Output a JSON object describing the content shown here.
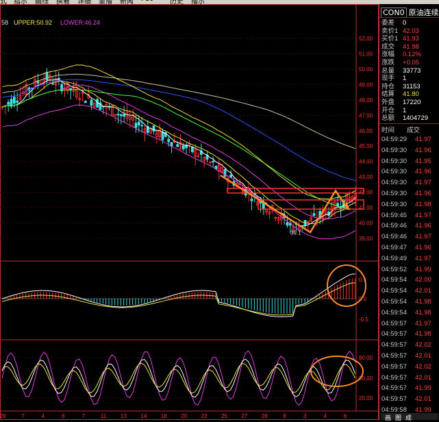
{
  "menu": [
    "式",
    "指示",
    "画线",
    "换着",
    "详细",
    "重播",
    "新闻",
    "F10",
    "历史",
    "播示"
  ],
  "legend": {
    "mid": "58",
    "upper": "UPPER:50.92",
    "lower": "LOWER:46.24"
  },
  "price_axis": [
    "52.00",
    "51.00",
    "50.00",
    "49.00",
    "48.00",
    "47.00",
    "46.00",
    "45.00",
    "44.00",
    "43.00",
    "42.00",
    "41.00",
    "40.00",
    "39.00"
  ],
  "low_label": "39.1",
  "macd_axis": [
    "0.5",
    "0.0",
    "-0.5"
  ],
  "kdj_axis": [
    "80.00",
    "50.00",
    "20.00"
  ],
  "date_axis": [
    "29",
    "7",
    "4",
    "6",
    "7",
    "11",
    "13",
    "14",
    "18",
    "20",
    "22",
    "25",
    "27",
    "28",
    "8",
    "3",
    "4",
    "6"
  ],
  "colors": {
    "up": "#ff3030",
    "down": "#40e0e0",
    "border": "#c03030",
    "annotation": "#ff8c30"
  },
  "quote": {
    "symbol": "CON0",
    "name": "原油连续",
    "rows": [
      {
        "k": "委差",
        "v": "0",
        "c": "white"
      },
      {
        "k": "卖价1",
        "v": "42.03",
        "c": "red"
      },
      {
        "k": "买价1",
        "v": "41.93",
        "c": "red"
      },
      {
        "k": "成交",
        "v": "41.98",
        "c": "red"
      },
      {
        "k": "涨幅",
        "v": "0.12%",
        "c": "red"
      },
      {
        "k": "涨跌",
        "v": "+0.05",
        "c": "red"
      },
      {
        "k": "总量",
        "v": "33773",
        "c": "white"
      },
      {
        "k": "现手",
        "v": "1",
        "c": "white"
      },
      {
        "k": "持仓",
        "v": "31153",
        "c": "white"
      },
      {
        "k": "结算",
        "v": "41.80",
        "c": "yellow"
      },
      {
        "k": "外盘",
        "v": "17220",
        "c": "white"
      },
      {
        "k": "开仓",
        "v": "1",
        "c": "white"
      },
      {
        "k": "总额",
        "v": "1404729",
        "c": "white"
      }
    ]
  },
  "ticks_header": {
    "time": "时间",
    "price": "成交"
  },
  "ticks": [
    {
      "t": "04:59:29",
      "p": "41.97"
    },
    {
      "t": "04:59:30",
      "p": "41.96"
    },
    {
      "t": "04:59:30",
      "p": "41.95"
    },
    {
      "t": "04:59:30",
      "p": "41.96"
    },
    {
      "t": "04:59:30",
      "p": "41.97"
    },
    {
      "t": "04:59:30",
      "p": "41.96"
    },
    {
      "t": "04:59:30",
      "p": "41.98"
    },
    {
      "t": "04:59:45",
      "p": "41.97"
    },
    {
      "t": "04:59:46",
      "p": "41.96"
    },
    {
      "t": "04:59:46",
      "p": "41.97"
    },
    {
      "t": "04:59:47",
      "p": "41.96"
    },
    {
      "t": "04:59:49",
      "p": "41.97"
    },
    {
      "t": "04:59:52",
      "p": "41.99"
    },
    {
      "t": "04:59:54",
      "p": "42.00"
    },
    {
      "t": "04:59:54",
      "p": "42.01"
    },
    {
      "t": "04:59:54",
      "p": "41.98"
    },
    {
      "t": "04:59:54",
      "p": "41.98"
    },
    {
      "t": "04:59:57",
      "p": "41.97"
    },
    {
      "t": "04:59:57",
      "p": "41.98"
    },
    {
      "t": "04:59:57",
      "p": "42.02"
    },
    {
      "t": "04:59:57",
      "p": "42.01"
    },
    {
      "t": "04:59:57",
      "p": "42.02"
    },
    {
      "t": "04:59:57",
      "p": "42.01"
    },
    {
      "t": "04:59:57",
      "p": "41.99"
    },
    {
      "t": "04:59:57",
      "p": "42.01"
    },
    {
      "t": "04:59:58",
      "p": "41.99"
    }
  ],
  "bottom_tabs": [
    "画",
    "图",
    "成"
  ]
}
